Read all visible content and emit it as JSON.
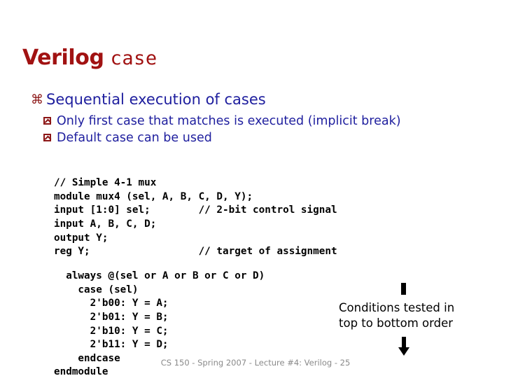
{
  "slide": {
    "title": {
      "word": "Verilog",
      "code": "case"
    },
    "colors": {
      "title_red": "#a11212",
      "bullet_blue": "#1e1e9e",
      "bullet_glyph_red": "#8c1616",
      "code_black": "#000000",
      "footer_gray": "#8a8a8a",
      "background": "#ffffff"
    },
    "bullets": [
      {
        "glyph": "z",
        "glyph_icon": "wingding-flower-bullet",
        "text": "Sequential execution of cases",
        "sub_bullets": [
          {
            "glyph": "y",
            "glyph_icon": "wingding-box-caret-bullet",
            "text": "Only first case that matches is executed (implicit break)"
          },
          {
            "glyph": "y",
            "glyph_icon": "wingding-box-caret-bullet",
            "text": "Default case can be used"
          }
        ]
      }
    ],
    "code_block_1": "// Simple 4-1 mux\nmodule mux4 (sel, A, B, C, D, Y);\ninput [1:0] sel;        // 2-bit control signal\ninput A, B, C, D;\noutput Y;\nreg Y;                  // target of assignment",
    "code_block_2": "  always @(sel or A or B or C or D)\n    case (sel)\n      2'b00: Y = A;\n      2'b01: Y = B;\n      2'b10: Y = C;\n      2'b11: Y = D;\n    endcase\nendmodule",
    "annotation": {
      "line1": "Conditions tested in",
      "line2": "top to bottom order",
      "arrow_top_icon": "bar-icon",
      "arrow_bottom_icon": "arrow-down-icon"
    },
    "footer": "CS 150 - Spring 2007 - Lecture #4: Verilog - 25"
  }
}
